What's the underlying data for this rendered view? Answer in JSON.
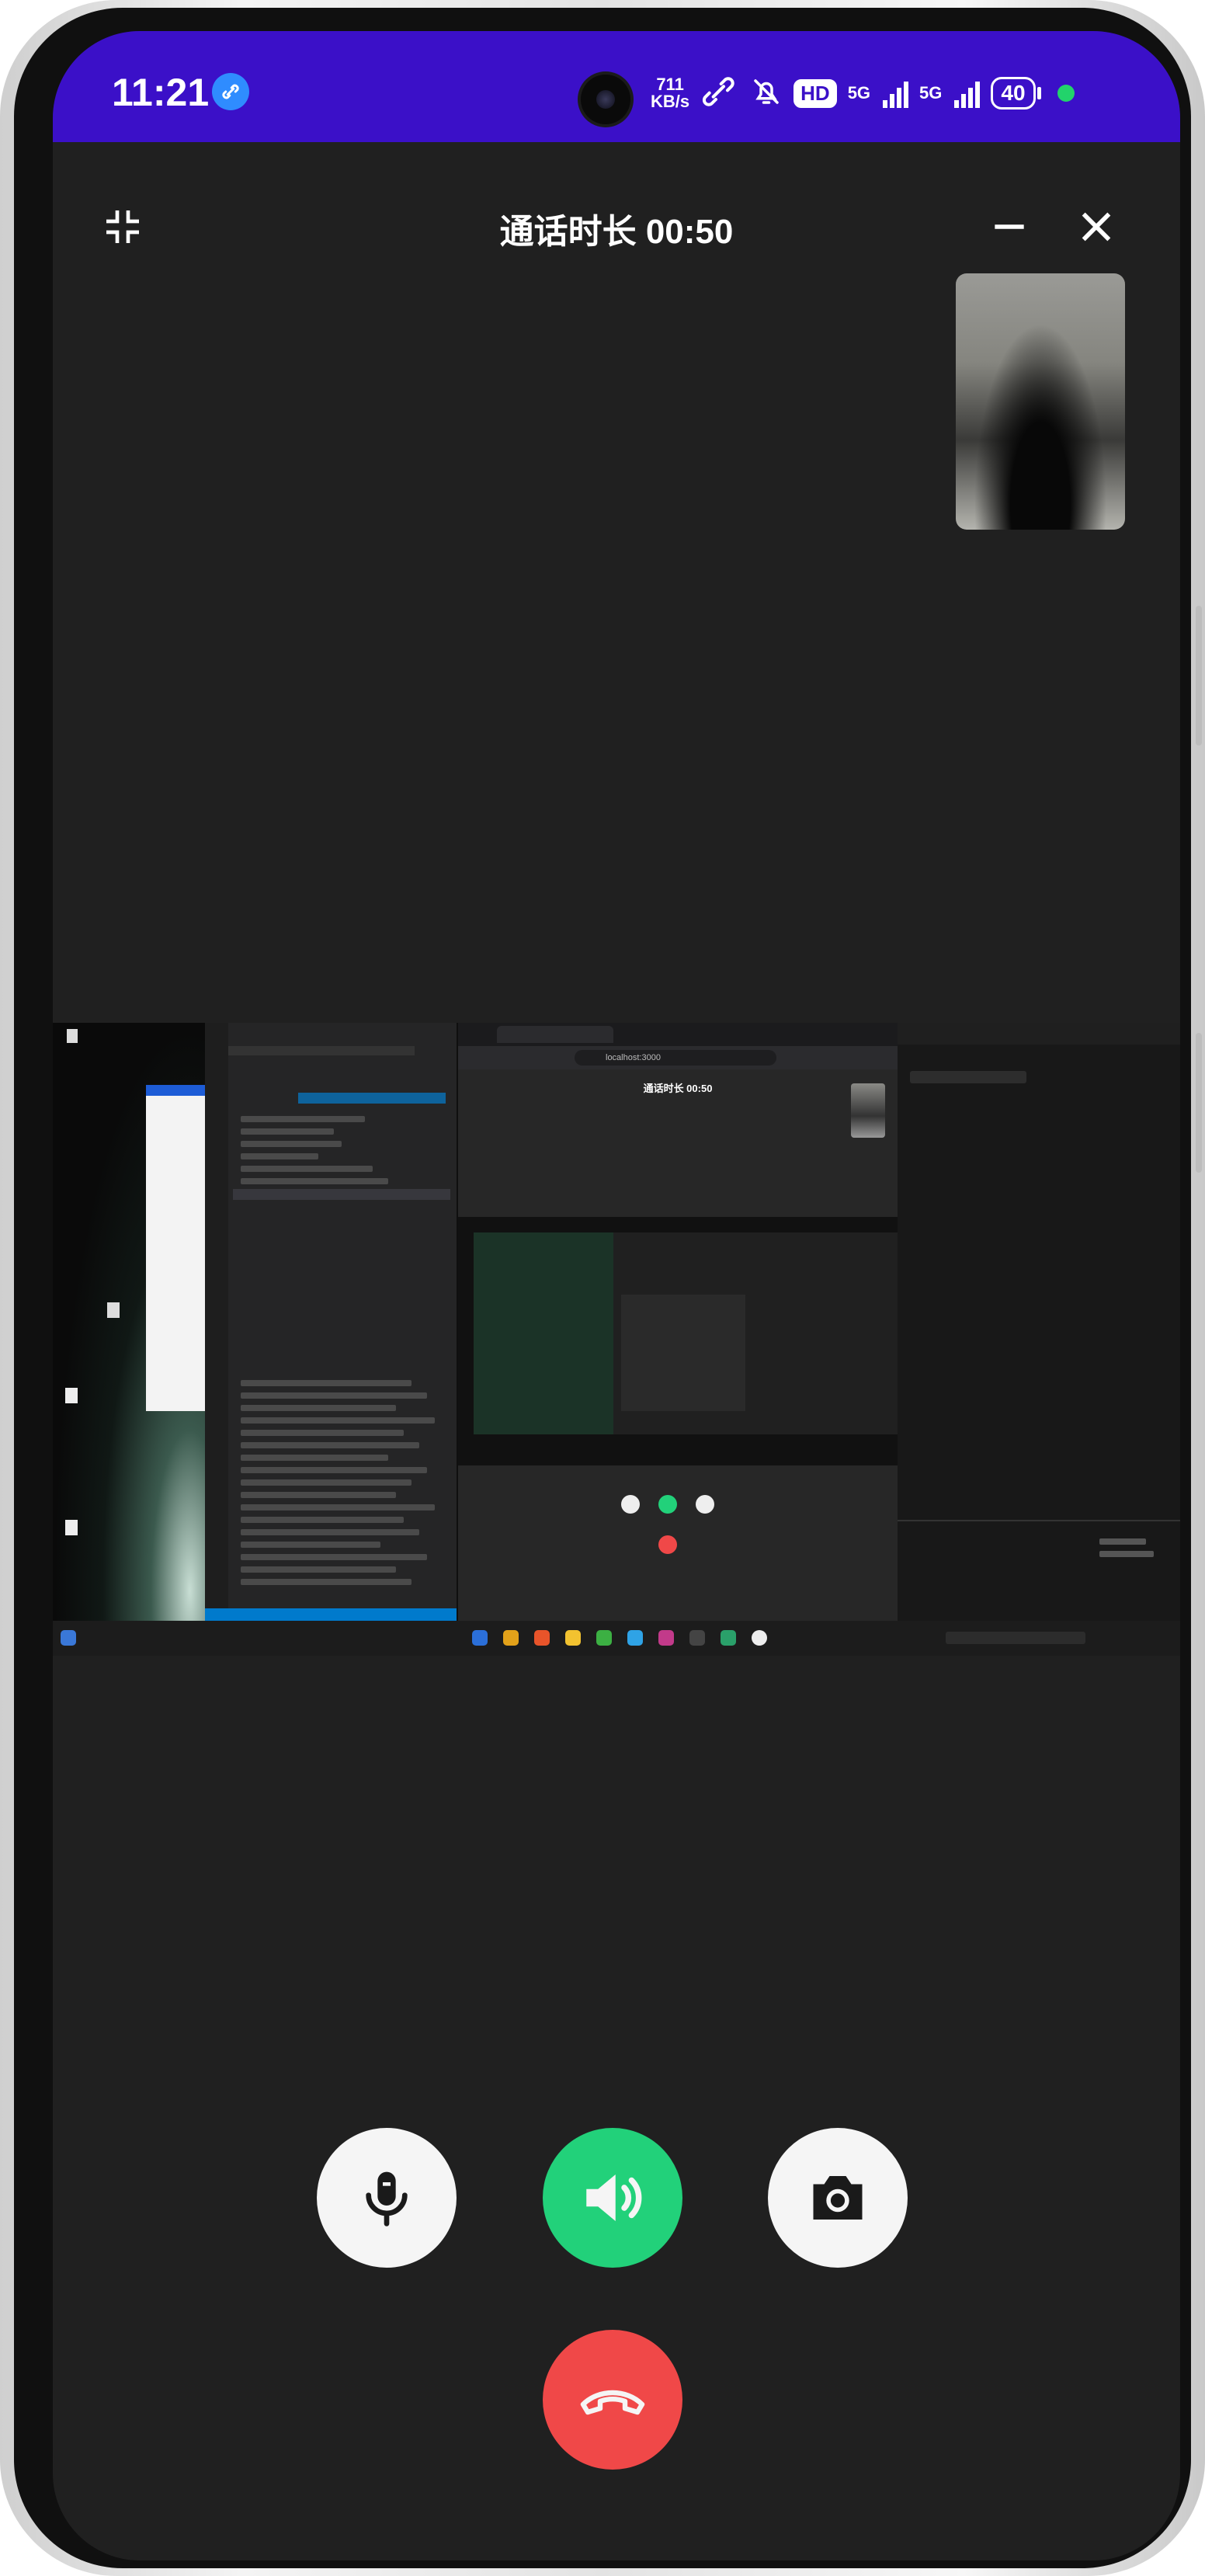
{
  "status_bar": {
    "time": "11:21",
    "net_speed_value": "711",
    "net_speed_unit": "KB/s",
    "hd_badge": "HD",
    "signal1_label": "5G",
    "signal2_label": "5G",
    "battery": "40"
  },
  "call": {
    "title": "通话时长 00:50"
  },
  "shared_screen": {
    "inner_call_title": "通话时长 00:50",
    "url": "localhost:3000"
  },
  "colors": {
    "status_bar": "#3b10c8",
    "background": "#202020",
    "speaker_active": "#22d17a",
    "hangup": "#f04848"
  }
}
